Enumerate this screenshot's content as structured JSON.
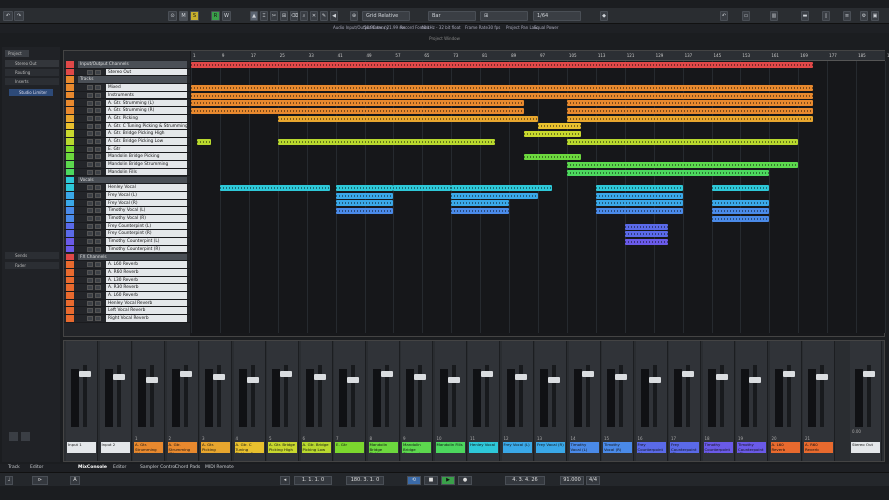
{
  "toolbar": {
    "quantize_mode": "Grid Relative",
    "grid_type": "Bar",
    "quantize": "1/64",
    "buttons": [
      "M",
      "S",
      "R",
      "W"
    ]
  },
  "infobar": {
    "items": [
      "Audio Input/Output Latency",
      "58.96 ms / 21.99 ms",
      "Record Format",
      "48 kHz - 32 bit float",
      "Frame Rate",
      "30 fps",
      "Project Pan Law",
      "Equal Power"
    ]
  },
  "editor_title": "Project Window",
  "left_zone": {
    "tabs": [
      "Project",
      "Visibility"
    ],
    "sections": [
      "Stereo Out",
      "Routing",
      "Inserts",
      "Sends",
      "Fader"
    ],
    "insert_slot": "Studio Limiter"
  },
  "ruler": {
    "bars": [
      "1",
      "9",
      "17",
      "25",
      "33",
      "41",
      "49",
      "57",
      "65",
      "73",
      "81",
      "89",
      "97",
      "105",
      "113",
      "121",
      "129",
      "137",
      "145",
      "153",
      "161",
      "169",
      "177",
      "185",
      "193"
    ]
  },
  "tracks": [
    {
      "name": "Input/Output Channels",
      "color": "#e04848",
      "type": "folder"
    },
    {
      "name": "Stereo Out",
      "color": "#e04848"
    },
    {
      "name": "Tracks",
      "color": "#e8892e",
      "type": "folder"
    },
    {
      "name": "Mixed",
      "color": "#e8892e"
    },
    {
      "name": "Instruments",
      "color": "#e8892e"
    },
    {
      "name": "A. Gtr. Strumming (L)",
      "color": "#e8892e"
    },
    {
      "name": "A. Gtr. Strumming (R)",
      "color": "#e8892e"
    },
    {
      "name": "A. Gtr. Picking",
      "color": "#e8a62e"
    },
    {
      "name": "A. Gtr. C Tuning Picking & Strumming",
      "color": "#e8c02e"
    },
    {
      "name": "A. Gtr. Bridge Picking High",
      "color": "#c8d82e"
    },
    {
      "name": "A. Gtr. Bridge Picking Low",
      "color": "#b8d82e"
    },
    {
      "name": "E. Gtr",
      "color": "#7cd82e"
    },
    {
      "name": "Mandolin Bridge Picking",
      "color": "#6cd83e"
    },
    {
      "name": "Mandolin Bridge Strumming",
      "color": "#5cd84e"
    },
    {
      "name": "Mandolin Fills",
      "color": "#4cd85e"
    },
    {
      "name": "Vocals",
      "color": "#2ec8d8",
      "type": "folder"
    },
    {
      "name": "Henley Vocal",
      "color": "#2ec8d8"
    },
    {
      "name": "Frey Vocal (L)",
      "color": "#3aa8e8"
    },
    {
      "name": "Frey Vocal (R)",
      "color": "#3aa8e8"
    },
    {
      "name": "Timothy Vocal (L)",
      "color": "#4a8ae8"
    },
    {
      "name": "Timothy Vocal (R)",
      "color": "#4a8ae8"
    },
    {
      "name": "Frey Counterpint (L)",
      "color": "#5a6ae8"
    },
    {
      "name": "Frey Counterpint (R)",
      "color": "#5a6ae8"
    },
    {
      "name": "Timothy Counterpint (L)",
      "color": "#6a5ae8"
    },
    {
      "name": "Timothy Counterpint (R)",
      "color": "#6a5ae8"
    },
    {
      "name": "FX Channels",
      "color": "#e04848",
      "type": "folder"
    },
    {
      "name": "A. L60 Reverb",
      "color": "#e86a2e"
    },
    {
      "name": "A. R60 Reverb",
      "color": "#e86a2e"
    },
    {
      "name": "A. L30 Reverb",
      "color": "#e86a2e"
    },
    {
      "name": "A. R30 Reverb",
      "color": "#e86a2e"
    },
    {
      "name": "A. L60 Reverb",
      "color": "#e86a2e"
    },
    {
      "name": "Henley Vocal Reverb",
      "color": "#e86a2e"
    },
    {
      "name": "Left Vocal Reverb",
      "color": "#e86a2e"
    },
    {
      "name": "Right Vocal Reverb",
      "color": "#e86a2e"
    }
  ],
  "mixer": {
    "channels": [
      {
        "label": "Input 1",
        "num": "",
        "color": "#e4e7ea"
      },
      {
        "label": "Input 2",
        "num": "",
        "color": "#e4e7ea"
      },
      {
        "label": "A. Gtr. Strumming (L)",
        "num": "1",
        "color": "#e8892e"
      },
      {
        "label": "A. Gtr. Strumming (R)",
        "num": "2",
        "color": "#e8892e"
      },
      {
        "label": "A. Gtr. Picking",
        "num": "3",
        "color": "#e8a62e"
      },
      {
        "label": "A. Gtr. C Tuning Picking & Strumm",
        "num": "4",
        "color": "#e8c02e"
      },
      {
        "label": "A. Gtr. Bridge Picking High",
        "num": "5",
        "color": "#c8d82e"
      },
      {
        "label": "A. Gtr. Bridge Picking Low",
        "num": "6",
        "color": "#b8d82e"
      },
      {
        "label": "E. Gtr",
        "num": "7",
        "color": "#7cd82e"
      },
      {
        "label": "Mandolin Bridge Picking",
        "num": "8",
        "color": "#6cd83e"
      },
      {
        "label": "Mandolin Bridge Strumming",
        "num": "9",
        "color": "#5cd84e"
      },
      {
        "label": "Mandolin Fills",
        "num": "10",
        "color": "#4cd85e"
      },
      {
        "label": "Henley Vocal",
        "num": "11",
        "color": "#2ec8d8"
      },
      {
        "label": "Frey Vocal (L)",
        "num": "12",
        "color": "#3aa8e8"
      },
      {
        "label": "Frey Vocal (R)",
        "num": "13",
        "color": "#3aa8e8"
      },
      {
        "label": "Timothy Vocal (L)",
        "num": "14",
        "color": "#4a8ae8"
      },
      {
        "label": "Timothy Vocal (R)",
        "num": "15",
        "color": "#4a8ae8"
      },
      {
        "label": "Frey Counterpoint (L)",
        "num": "16",
        "color": "#5a6ae8"
      },
      {
        "label": "Frey Counterpoint (R)",
        "num": "17",
        "color": "#5a6ae8"
      },
      {
        "label": "Timothy Counterpoint (L)",
        "num": "18",
        "color": "#6a5ae8"
      },
      {
        "label": "Timothy Counterpoint (R)",
        "num": "19",
        "color": "#6a5ae8"
      },
      {
        "label": "A. L60 Reverb",
        "num": "20",
        "color": "#e86a2e"
      },
      {
        "label": "A. R60 Reverb",
        "num": "21",
        "color": "#e86a2e"
      }
    ],
    "master": {
      "label": "Stereo Out",
      "value": "0.00"
    }
  },
  "bottom_tabs": [
    "Track",
    "Editor",
    "MixConsole",
    "Editor",
    "Sampler Control",
    "Chord Pads",
    "MIDI Remote"
  ],
  "transport": {
    "position_left": "1. 1. 1. 0",
    "position_right": "180. 3. 1. 0",
    "time_display": "4. 3. 4. 26",
    "tempo": "91.000",
    "signature": "4/4"
  }
}
